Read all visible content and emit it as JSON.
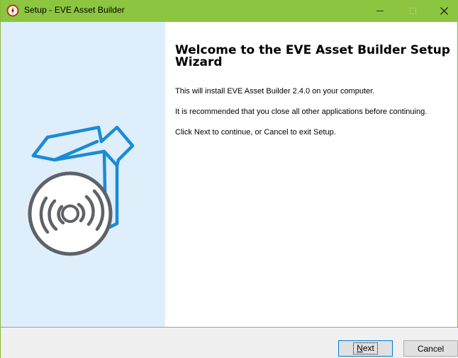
{
  "window": {
    "title": "Setup - EVE Asset Builder",
    "controls": {
      "minimize": "minimize-icon",
      "maximize": "maximize-icon",
      "close": "close-icon"
    }
  },
  "left_panel": {
    "image": "installer-box-cd-icon",
    "background": "#deeefa"
  },
  "content": {
    "heading": "Welcome to the EVE Asset Builder Setup Wizard",
    "paragraphs": [
      "This will install EVE Asset Builder 2.4.0 on your computer.",
      "It is recommended that you close all other applications before continuing.",
      "Click Next to continue, or Cancel to exit Setup."
    ]
  },
  "buttons": {
    "next_mnemonic": "N",
    "next_rest": "ext",
    "cancel": "Cancel"
  },
  "colors": {
    "titlebar": "#8cc53f",
    "accent": "#1a8bd6"
  }
}
